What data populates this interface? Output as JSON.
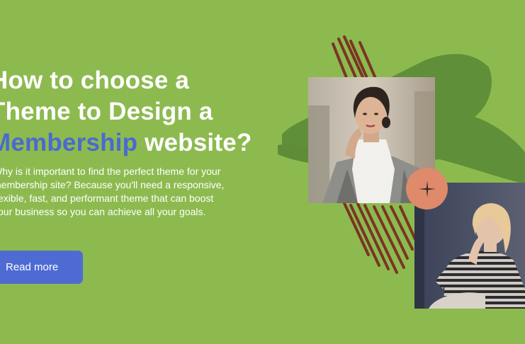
{
  "colors": {
    "background": "#8dba4f",
    "heading": "#ffffff",
    "accent": "#4a6ad0",
    "button": "#4e6bd3",
    "brush_green": "#5e8c38",
    "brush_red": "#7a2e22",
    "badge": "#de8a6b"
  },
  "heading": {
    "line1": "How to choose a",
    "line2_prefix": "Theme to Design a",
    "line3_accent": "Membership",
    "line3_rest": " website?"
  },
  "body": {
    "line1": "Why is it important to find the perfect theme for your",
    "line2": "membership site? Because you'll need a responsive,",
    "line3": "flexible, fast, and performant theme that can boost",
    "line4": "your business so you can achieve all your goals."
  },
  "cta": {
    "label": "Read more"
  },
  "icons": {
    "badge": "sparkle-icon"
  }
}
